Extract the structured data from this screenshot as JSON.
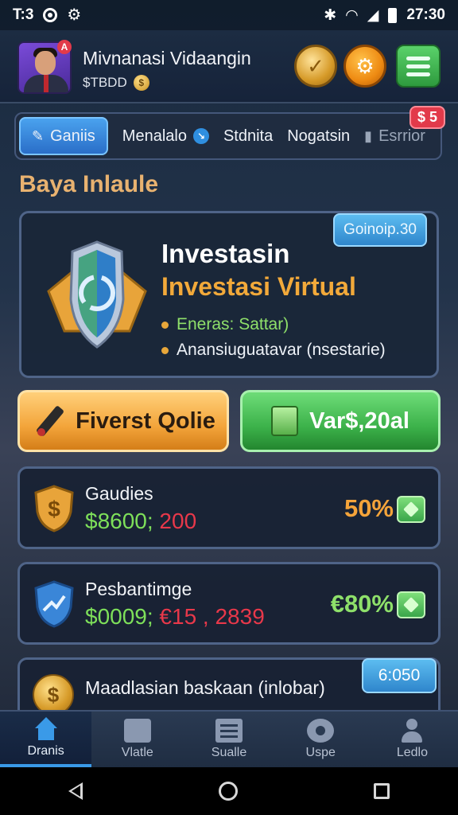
{
  "status_bar": {
    "left_text": "T:3",
    "time": "27:30"
  },
  "header": {
    "user_name": "Mivnanasi Vidaangin",
    "balance": "$TBDD",
    "avatar_badge": "A",
    "coin_symbol": "$"
  },
  "tabs": {
    "items": [
      {
        "label": "Ganiis"
      },
      {
        "label": "Menalalo"
      },
      {
        "label": "Stdnita"
      },
      {
        "label": "Nogatsin"
      },
      {
        "label": "Esrrior"
      }
    ],
    "badge": "$ 5"
  },
  "section_title": "Baya Inlaule",
  "feature_card": {
    "pill": "Goinoip.30",
    "title": "Investasin",
    "subtitle": "Investasi Virtual",
    "bullets": [
      "Eneras: Sattar)",
      "Anansiuguatavar (nsestarie)"
    ]
  },
  "actions": {
    "primary_label": "Fiverst Qolie",
    "secondary_label": "Var$,20al"
  },
  "cards": [
    {
      "title": "Gaudies",
      "value_green": "$8600;",
      "value_red": "200",
      "percent": "50%"
    },
    {
      "title": "Pesbantimge",
      "value_green": "$0009;",
      "value_red": "€15 , 2839",
      "percent": "€80%"
    },
    {
      "title": "Maadlasian baskaan (inlobar)",
      "pill": "6:050"
    }
  ],
  "bottom_nav": [
    {
      "label": "Dranis"
    },
    {
      "label": "Vlatle"
    },
    {
      "label": "Sualle"
    },
    {
      "label": "Uspe"
    },
    {
      "label": "Ledlo"
    }
  ],
  "colors": {
    "accent_blue": "#3a9ae8",
    "accent_orange": "#f5a43a",
    "accent_green": "#7ee05a",
    "accent_red": "#e8384a"
  }
}
